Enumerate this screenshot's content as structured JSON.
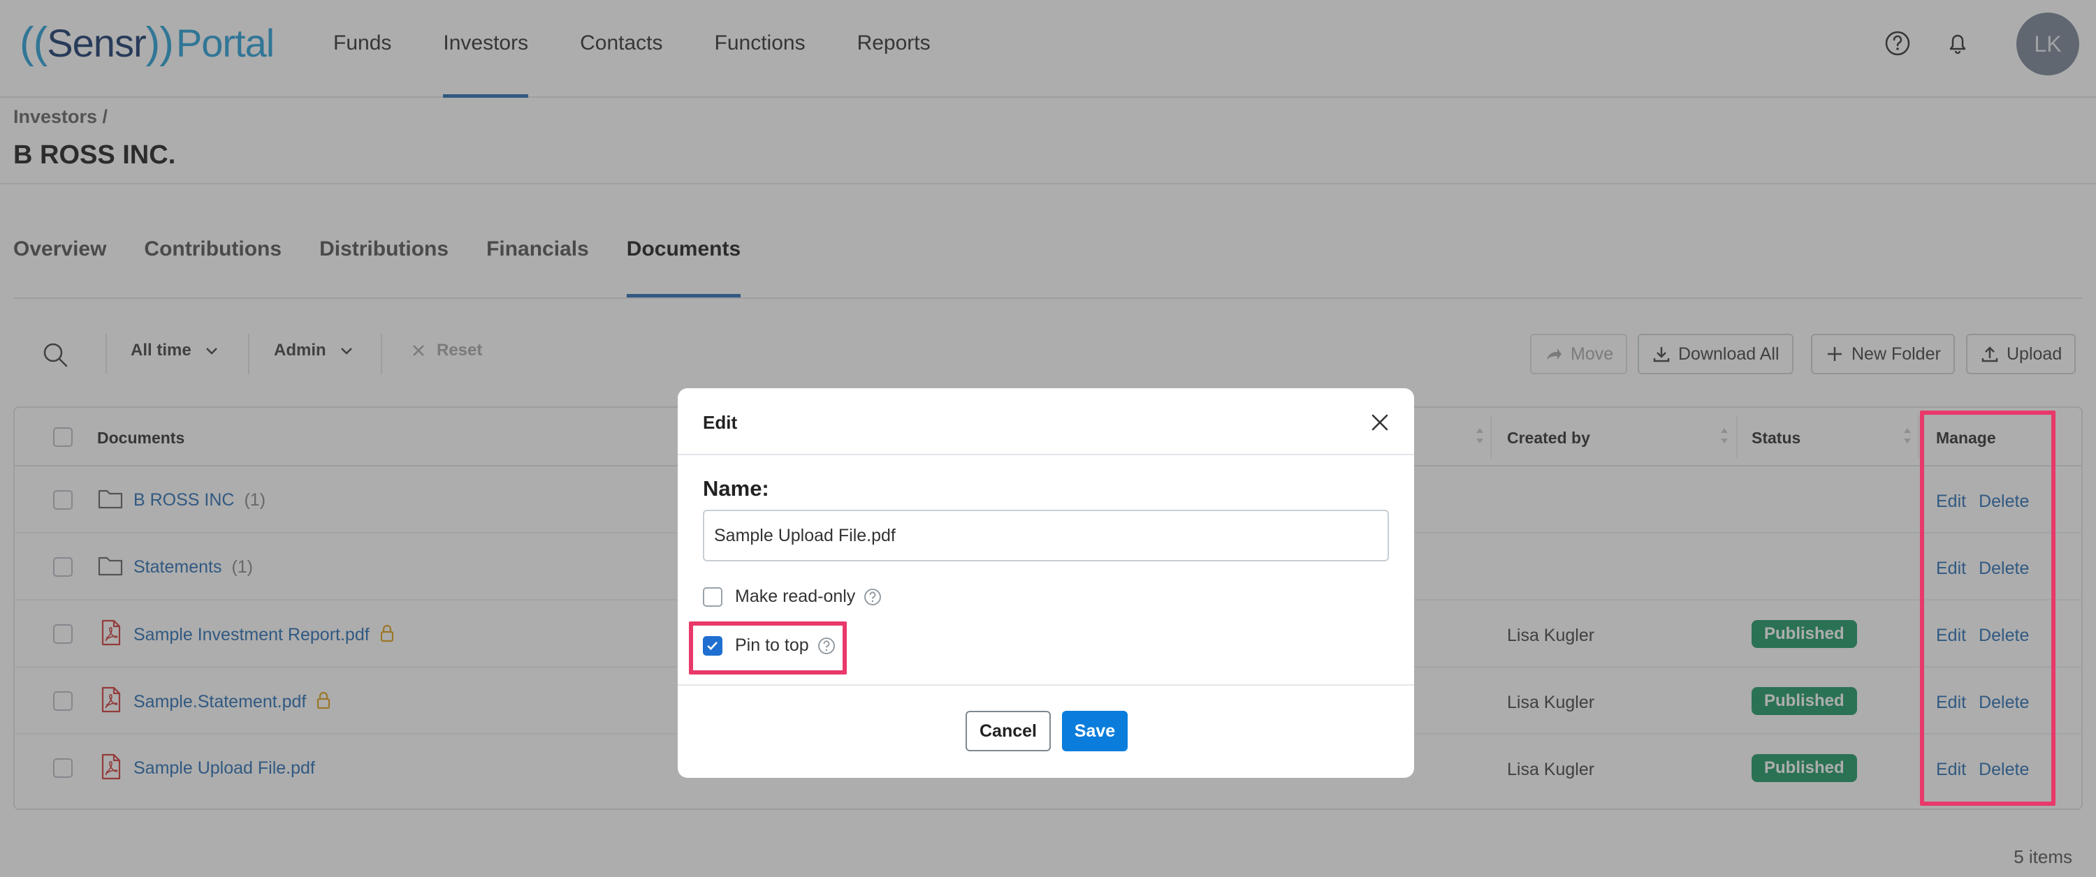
{
  "brand": {
    "paren_open": "((",
    "name": "Sensr",
    "paren_close": "))",
    "portal": "Portal"
  },
  "nav": [
    {
      "label": "Funds"
    },
    {
      "label": "Investors"
    },
    {
      "label": "Contacts"
    },
    {
      "label": "Functions"
    },
    {
      "label": "Reports"
    }
  ],
  "header": {
    "help_icon": "help-circle-icon",
    "bell_icon": "bell-icon",
    "avatar_initials": "LK"
  },
  "breadcrumb": "Investors /",
  "page_title": "B ROSS INC.",
  "tabs": [
    {
      "label": "Overview"
    },
    {
      "label": "Contributions"
    },
    {
      "label": "Distributions"
    },
    {
      "label": "Financials"
    },
    {
      "label": "Documents"
    }
  ],
  "toolbar": {
    "time_filter": "All time",
    "role_filter": "Admin",
    "reset": "Reset",
    "move": "Move",
    "download_all": "Download All",
    "new_folder": "New Folder",
    "upload": "Upload"
  },
  "table": {
    "headers": {
      "documents": "Documents",
      "created_by": "Created by",
      "status": "Status",
      "manage": "Manage"
    },
    "rows": [
      {
        "type": "folder",
        "name": "B ROSS INC",
        "count": "(1)",
        "locked": false,
        "created_by": "",
        "status": "",
        "edit": "Edit",
        "delete": "Delete"
      },
      {
        "type": "folder",
        "name": "Statements",
        "count": "(1)",
        "locked": false,
        "created_by": "",
        "status": "",
        "edit": "Edit",
        "delete": "Delete"
      },
      {
        "type": "pdf",
        "name": "Sample Investment Report.pdf",
        "count": "",
        "locked": true,
        "created_by": "Lisa Kugler",
        "status": "Published",
        "edit": "Edit",
        "delete": "Delete"
      },
      {
        "type": "pdf",
        "name": "Sample.Statement.pdf",
        "count": "",
        "locked": true,
        "created_by": "Lisa Kugler",
        "status": "Published",
        "edit": "Edit",
        "delete": "Delete"
      },
      {
        "type": "pdf",
        "name": "Sample Upload File.pdf",
        "count": "",
        "locked": false,
        "created_by": "Lisa Kugler",
        "status": "Published",
        "edit": "Edit",
        "delete": "Delete"
      }
    ],
    "footer": "5 items"
  },
  "modal": {
    "title": "Edit",
    "name_label": "Name:",
    "name_value": "Sample Upload File.pdf",
    "read_only_label": "Make read-only",
    "read_only_checked": false,
    "pin_label": "Pin to top",
    "pin_checked": true,
    "cancel": "Cancel",
    "save": "Save"
  },
  "colors": {
    "accent": "#2a6fb4",
    "published": "#1f9a66",
    "highlight": "#e8396a",
    "save": "#0a7ddc"
  }
}
